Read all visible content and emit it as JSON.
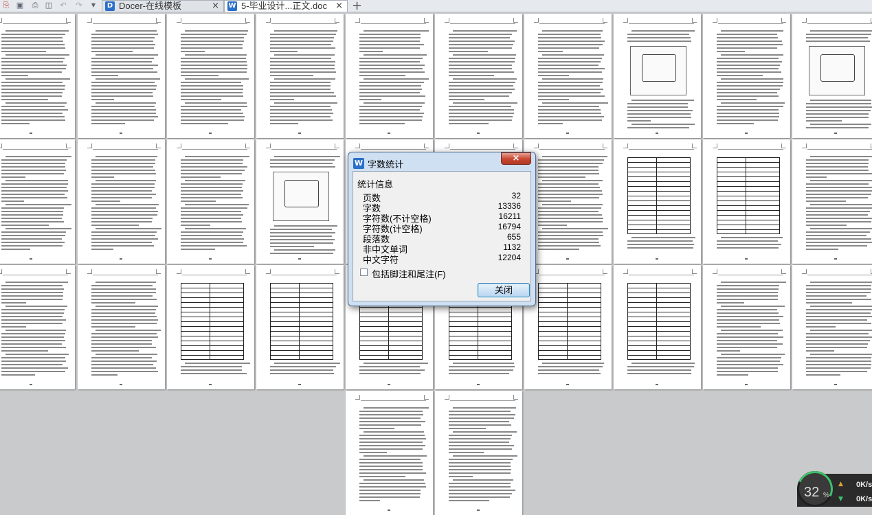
{
  "tabs": [
    {
      "label": "Docer-在线模板",
      "icon": "docer-icon"
    },
    {
      "label": "5-毕业设计...正文.doc",
      "icon": "wps-writer-icon"
    }
  ],
  "toolbar": {
    "icons": [
      "pdf-export-icon",
      "save-icon",
      "print-icon",
      "print-preview-icon",
      "undo-icon",
      "redo-icon",
      "quick-access-dropdown-icon"
    ]
  },
  "new_tab": "+",
  "dialog": {
    "title": "字数统计",
    "close_glyph": "×",
    "section_heading": "统计信息",
    "stats": [
      {
        "label": "页数",
        "value": "32"
      },
      {
        "label": "字数",
        "value": "13336"
      },
      {
        "label": "字符数(不计空格)",
        "value": "16211"
      },
      {
        "label": "字符数(计空格)",
        "value": "16794"
      },
      {
        "label": "段落数",
        "value": "655"
      },
      {
        "label": "非中文单词",
        "value": "1132"
      },
      {
        "label": "中文字符",
        "value": "12204"
      }
    ],
    "footnote_checkbox": {
      "label": "包括脚注和尾注(F)",
      "checked": false
    },
    "close_button": "关闭"
  },
  "net_widget": {
    "percent": "32",
    "percent_sign": "%",
    "upload": "0K/s",
    "download": "0K/s"
  },
  "colors": {
    "workspace": "#c9cacc",
    "dialog_frame": "#cfe0f3",
    "close_red": "#c6452f",
    "button_blue": "#3c7fb1",
    "net_green": "#3fbf6a"
  }
}
